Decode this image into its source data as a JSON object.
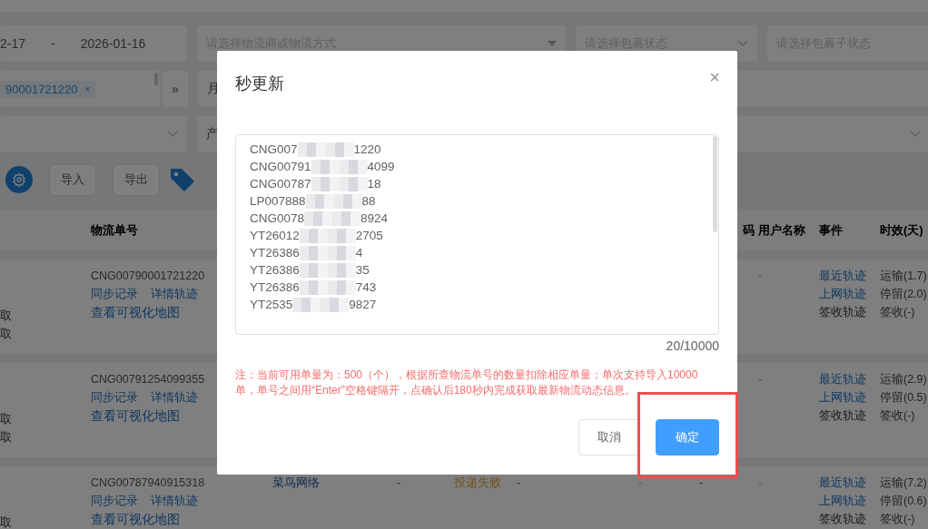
{
  "filters": {
    "date_start": "2-17",
    "date_separator": "-",
    "date_end": "2026-01-16",
    "carrier_placeholder": "请选择物流商或物流方式",
    "status_placeholder": "请选择包裹状态",
    "substatus_placeholder": "请选择包裹子状态",
    "tag": "90001721220",
    "tag_remove": "×",
    "expand": "»",
    "row2_partial": "月",
    "row3_partial": "产"
  },
  "toolbar": {
    "buttons": [
      "导入",
      "导出"
    ]
  },
  "table": {
    "header": {
      "tracking_no": "物流单号",
      "column_7": "码",
      "user_name": "用户名称",
      "events": "事件",
      "timeliness": "时效(天)"
    },
    "rows": [
      {
        "left_notes": [
          "取",
          "取"
        ],
        "tracking_no": "CNG00790001721220",
        "actions": [
          "同步记录",
          "详情轨迹"
        ],
        "map_link": "查看可视化地图",
        "user_name": {
          "text": "-",
          "kind": "danger"
        },
        "events": [
          {
            "label": "最近轨迹",
            "disabled": false
          },
          {
            "label": "上网轨迹",
            "disabled": false
          },
          {
            "label": "签收轨迹",
            "disabled": true
          }
        ],
        "timeliness": [
          "运输(1.7)",
          "停留(2.0)",
          "签收(-)"
        ]
      },
      {
        "left_notes": [
          "取",
          "取"
        ],
        "tracking_no": "CNG00791254099355",
        "actions": [
          "同步记录",
          "详情轨迹"
        ],
        "map_link": "查看可视化地图",
        "user_name": {
          "text": "-",
          "kind": "danger"
        },
        "events": [
          {
            "label": "最近轨迹",
            "disabled": false
          },
          {
            "label": "上网轨迹",
            "disabled": false
          },
          {
            "label": "签收轨迹",
            "disabled": true
          }
        ],
        "timeliness": [
          "运输(2.9)",
          "停留(0.5)",
          "签收(-)"
        ]
      },
      {
        "left_notes": [
          "取"
        ],
        "tracking_no": "CNG00787940915318",
        "actions": [
          "同步记录",
          "详情轨迹"
        ],
        "map_link": "查看可视化地图",
        "carrier": "菜鸟网络",
        "column_3": {
          "text": "-",
          "kind": "normal"
        },
        "status": {
          "text": "投递失败",
          "kind": "warning"
        },
        "column_5": {
          "text": "-",
          "kind": "normal"
        },
        "column_6": {
          "text": "-",
          "kind": "warning"
        },
        "column_7": {
          "text": "-",
          "kind": "normal"
        },
        "user_name": {
          "text": "-",
          "kind": "warning"
        },
        "events": [
          {
            "label": "最近轨迹",
            "disabled": false
          },
          {
            "label": "上网轨迹",
            "disabled": false
          },
          {
            "label": "签收轨迹",
            "disabled": true
          }
        ],
        "timeliness": [
          "运输(7.2)",
          "停留(0.6)",
          "签收(-)"
        ]
      }
    ]
  },
  "dialog": {
    "title": "秒更新",
    "close": "×",
    "lines": [
      {
        "start": "CNG007",
        "end": "1220"
      },
      {
        "start": "CNG00791",
        "end": "4099"
      },
      {
        "start": "CNG00787",
        "end": "18"
      },
      {
        "start": "LP007888",
        "end": "88"
      },
      {
        "start": "CNG0078",
        "end": "8924"
      },
      {
        "start": "YT26012",
        "end": "2705"
      },
      {
        "start": "YT26386",
        "end": "4"
      },
      {
        "start": "YT26386",
        "end": "35"
      },
      {
        "start": "YT26386",
        "end": "743"
      },
      {
        "start": "YT2535",
        "end": "9827"
      }
    ],
    "count": "20/10000",
    "note": "注：当前可用单量为：500（个），根据所查物流单号的数量扣除相应单量；单次支持导入10000单，单号之间用“Enter”空格键隔开，点确认后180秒内完成获取最新物流动态信息。",
    "buttons": [
      {
        "kind": "cancel",
        "label": "取消",
        "highlighted": false
      },
      {
        "kind": "confirm",
        "label": "确定",
        "highlighted": true
      }
    ]
  }
}
